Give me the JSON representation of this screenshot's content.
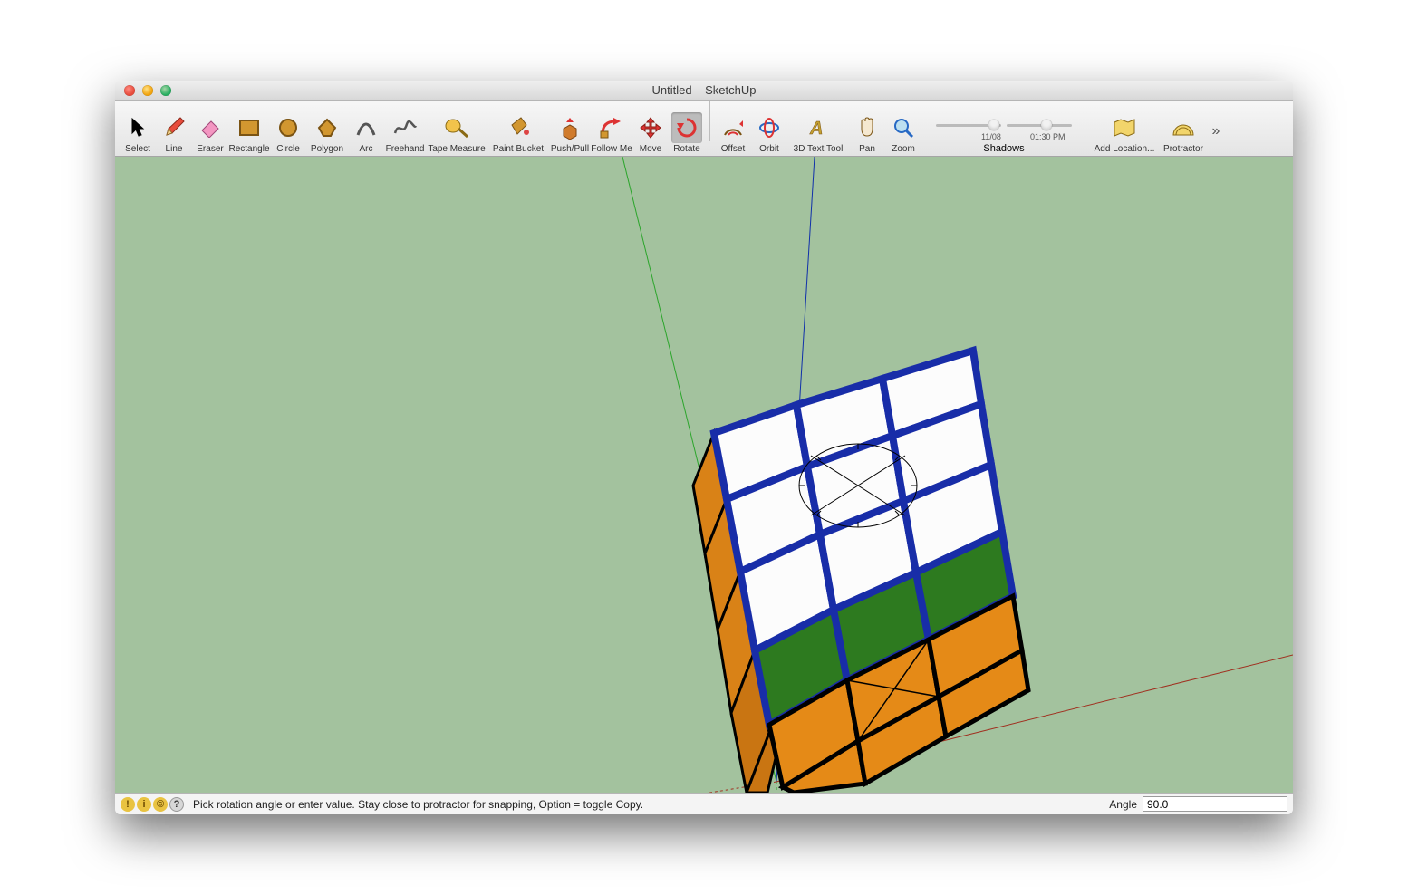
{
  "title": "Untitled – SketchUp",
  "tools": [
    {
      "id": "select",
      "label": "Select"
    },
    {
      "id": "line",
      "label": "Line"
    },
    {
      "id": "eraser",
      "label": "Eraser"
    },
    {
      "id": "rectangle",
      "label": "Rectangle"
    },
    {
      "id": "circle",
      "label": "Circle"
    },
    {
      "id": "polygon",
      "label": "Polygon"
    },
    {
      "id": "arc",
      "label": "Arc"
    },
    {
      "id": "freehand",
      "label": "Freehand"
    },
    {
      "id": "tape",
      "label": "Tape Measure"
    },
    {
      "id": "paint",
      "label": "Paint Bucket"
    },
    {
      "id": "pushpull",
      "label": "Push/Pull"
    },
    {
      "id": "follow",
      "label": "Follow Me"
    },
    {
      "id": "move",
      "label": "Move"
    },
    {
      "id": "rotate",
      "label": "Rotate",
      "active": true
    },
    {
      "id": "offset",
      "label": "Offset"
    },
    {
      "id": "orbit",
      "label": "Orbit"
    },
    {
      "id": "text3d",
      "label": "3D Text Tool"
    },
    {
      "id": "pan",
      "label": "Pan"
    },
    {
      "id": "zoom",
      "label": "Zoom"
    },
    {
      "id": "addloc",
      "label": "Add Location..."
    },
    {
      "id": "protractor",
      "label": "Protractor"
    }
  ],
  "shadows": {
    "label": "Shadows",
    "date": "11/08",
    "time": "01:30 PM"
  },
  "status": {
    "hint": "Pick rotation angle or enter value.  Stay close to protractor for snapping, Option = toggle Copy.",
    "angle_label": "Angle",
    "angle_value": "90.0"
  },
  "colors": {
    "frame": "#182da8",
    "white": "#fafafa",
    "orange": "#e58a17",
    "green": "#2d7a1f",
    "bg": "#a3c29e"
  }
}
